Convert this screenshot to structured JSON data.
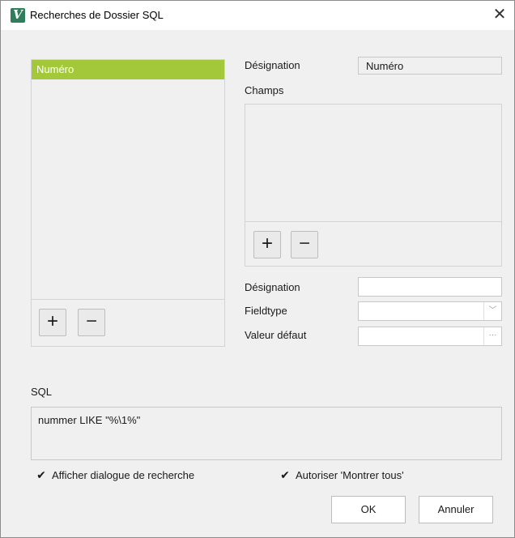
{
  "window": {
    "title": "Recherches de Dossier SQL",
    "app_icon_letter": "V",
    "close_glyph": "✕"
  },
  "left_list": {
    "items": [
      "Numéro"
    ],
    "selected_index": 0,
    "selected_color": "#a3c93a",
    "add_glyph": "+",
    "remove_glyph": "−"
  },
  "top_form": {
    "designation_label": "Désignation",
    "designation_value": "Numéro",
    "champs_label": "Champs"
  },
  "champs": {
    "items": [],
    "add_glyph": "+",
    "remove_glyph": "−"
  },
  "field_form": {
    "designation_label": "Désignation",
    "designation_value": "",
    "fieldtype_label": "Fieldtype",
    "fieldtype_value": "",
    "fieldtype_arrow": "﹀",
    "valeur_label": "Valeur défaut",
    "valeur_value": "",
    "valeur_button": "···"
  },
  "sql": {
    "label": "SQL",
    "value": "nummer LIKE \"%\\1%\""
  },
  "options": {
    "afficher_label": "Afficher dialogue de recherche",
    "afficher_checked": true,
    "autoriser_label": "Autoriser 'Montrer tous'",
    "autoriser_checked": true,
    "check_glyph": "✔"
  },
  "buttons": {
    "ok_label": "OK",
    "annuler_label": "Annuler"
  }
}
